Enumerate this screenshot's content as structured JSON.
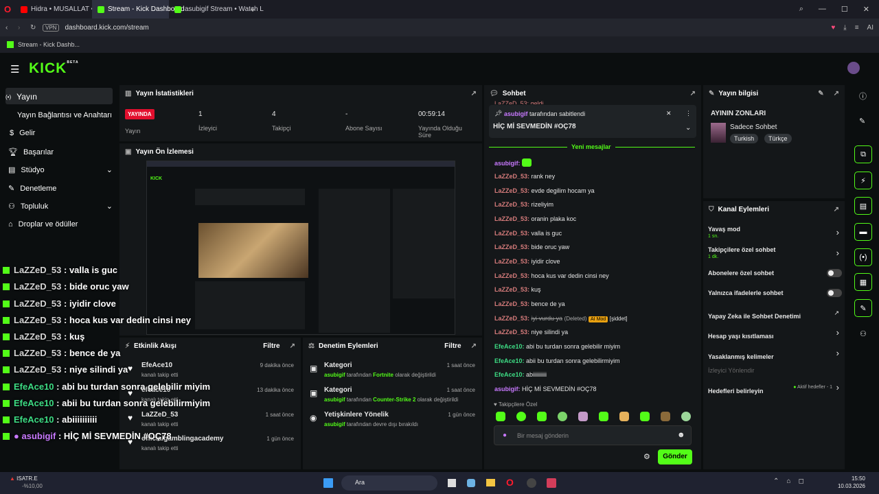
{
  "browser": {
    "tabs": [
      "Hidra • MUSALLAT • YouT",
      "Stream - Kick Dashboard",
      "asubigif Stream • Watch L"
    ],
    "url": "dashboard.kick.com/stream",
    "vpn": "VPN",
    "bookmark": "Stream - Kick Dashb...",
    "ai_label": "AI"
  },
  "header": {
    "logo": "KICK",
    "beta": "BETA"
  },
  "sidebar": {
    "items": [
      "Yayın",
      "Yayın Bağlantısı ve Anahtarı",
      "Gelir",
      "Başarılar",
      "Stüdyo",
      "Denetleme",
      "Topluluk",
      "Droplar ve ödüller"
    ]
  },
  "stats": {
    "title": "Yayın İstatistikleri",
    "live": "YAYINDA",
    "live_label": "Yayın",
    "viewers": "1",
    "viewers_label": "İzleyici",
    "followers": "4",
    "followers_label": "Takipçi",
    "subs": "-",
    "subs_label": "Abone Sayısı",
    "uptime": "00:59:14",
    "uptime_label": "Yayında Olduğu Süre"
  },
  "preview": {
    "title": "Yayın Ön İzlemesi"
  },
  "activity": {
    "title": "Etkinlik Akışı",
    "filter": "Filtre",
    "items": [
      {
        "user": "EfeAce10",
        "text": "kanalı takip etti",
        "time": "9 dakika önce"
      },
      {
        "user": "efeace10",
        "text": "kanalı takip etti",
        "time": "13 dakika önce"
      },
      {
        "user": "LaZZeD_53",
        "text": "kanalı takip etti",
        "time": "1 saat önce"
      },
      {
        "user": "officialgamblingacademy",
        "text": "kanalı takip etti",
        "time": "1 gün önce"
      }
    ]
  },
  "moderation": {
    "title": "Denetim Eylemleri",
    "filter": "Filtre",
    "items": [
      {
        "title": "Kategori",
        "user": "asubigif",
        "pre": "tarafından",
        "target": "Fortnite",
        "post": "olarak değiştirildi",
        "time": "1 saat önce"
      },
      {
        "title": "Kategori",
        "user": "asubigif",
        "pre": "tarafından",
        "target": "Counter-Strike 2",
        "post": "olarak değiştirildi",
        "time": "1 saat önce"
      },
      {
        "title": "Yetişkinlere Yönelik",
        "user": "asubigif",
        "pre": "tarafından devre dışı bırakıldı",
        "target": "",
        "post": "",
        "time": "1 gün önce"
      }
    ]
  },
  "chat": {
    "title": "Sohbet",
    "top_cut": "LaZZeD_53: geldi",
    "pinned_user": "asubigif",
    "pinned_by": "tarafından sabitlendi",
    "pinned_msg": "HİÇ Mİ SEVMEDİN #OÇ78",
    "new_messages": "Yeni mesajlar",
    "messages": [
      {
        "u": "asubigif",
        "m": "",
        "c": "u3"
      },
      {
        "u": "LaZZeD_53",
        "m": "rank ney",
        "c": "u"
      },
      {
        "u": "LaZZeD_53",
        "m": "evde degilim hocam ya",
        "c": "u"
      },
      {
        "u": "LaZZeD_53",
        "m": "rizeliyim",
        "c": "u"
      },
      {
        "u": "LaZZeD_53",
        "m": "oranin plaka koc",
        "c": "u"
      },
      {
        "u": "LaZZeD_53",
        "m": "valla is guc",
        "c": "u"
      },
      {
        "u": "LaZZeD_53",
        "m": "bide oruc yaw",
        "c": "u"
      },
      {
        "u": "LaZZeD_53",
        "m": "iyidir clove",
        "c": "u"
      },
      {
        "u": "LaZZeD_53",
        "m": "hoca kus var dedin cinsi ney",
        "c": "u"
      },
      {
        "u": "LaZZeD_53",
        "m": "kuş",
        "c": "u"
      },
      {
        "u": "LaZZeD_53",
        "m": "bence de ya",
        "c": "u"
      },
      {
        "u": "LaZZeD_53",
        "m": "iyi vurdu ya",
        "c": "u"
      },
      {
        "u": "LaZZeD_53",
        "m": "niye silindi ya",
        "c": "u"
      },
      {
        "u": "EfeAce10",
        "m": "abi bu turdan sonra gelebilir miyim",
        "c": "u2"
      },
      {
        "u": "EfeAce10",
        "m": "abii bu turdan sonra gelebilirmiyim",
        "c": "u2"
      },
      {
        "u": "EfeAce10",
        "m": "abiiiiiiiiii",
        "c": "u2"
      },
      {
        "u": "asubigif",
        "m": "HİÇ Mİ SEVMEDİN #OÇ78",
        "c": "u3"
      }
    ],
    "deleted": "(Deleted)",
    "ai_mod": "AI Mod",
    "violence": "[şiddet]",
    "follower_only": "Takipçilere Özel",
    "placeholder": "Bir mesaj gönderin",
    "send": "Gönder"
  },
  "info": {
    "title": "Yayın bilgisi",
    "stream_title": "AYININ ZONLARI",
    "category": "Sadece Sohbet",
    "tags": [
      "Turkish",
      "Türkçe"
    ]
  },
  "actions": {
    "title": "Kanal Eylemleri",
    "slow": "Yavaş mod",
    "slow_val": "1 sn.",
    "followers": "Takipçilere özel sohbet",
    "followers_val": "1 dk.",
    "subs": "Abonelere özel sohbet",
    "emotes": "Yalnızca ifadelerle sohbet",
    "ai": "Yapay Zeka ile Sohbet Denetimi",
    "age": "Hesap yaşı kısıtlaması",
    "banned": "Yasaklanmış kelimeler",
    "redirect": "İzleyici Yönlendir",
    "goals": "Hedefleri belirleyin",
    "goals_val": "Aktif hedefler - 1"
  },
  "overlay": [
    {
      "u": "LaZZeD_53",
      "m": "valla is guc",
      "c": "n"
    },
    {
      "u": "LaZZeD_53",
      "m": "bide oruc yaw",
      "c": "n"
    },
    {
      "u": "LaZZeD_53",
      "m": "iyidir clove",
      "c": "n"
    },
    {
      "u": "LaZZeD_53",
      "m": "hoca kus var dedin cinsi ney",
      "c": "n"
    },
    {
      "u": "LaZZeD_53",
      "m": "kuş",
      "c": "n"
    },
    {
      "u": "LaZZeD_53",
      "m": "bence de ya",
      "c": "n"
    },
    {
      "u": "LaZZeD_53",
      "m": "niye silindi ya",
      "c": "n"
    },
    {
      "u": "EfeAce10",
      "m": "abi bu turdan sonra gelebilir miyim",
      "c": "n2"
    },
    {
      "u": "EfeAce10",
      "m": "abii bu turdan sonra gelebilirmiyim",
      "c": "n2"
    },
    {
      "u": "EfeAce10",
      "m": "abiiiiiiiiii",
      "c": "n2"
    },
    {
      "u": "asubigif",
      "m": "HİÇ Mİ SEVMEDİN #OÇ78",
      "c": "n3"
    }
  ],
  "taskbar": {
    "ticker": "ISATR.E",
    "change": "-%10,00",
    "search": "Ara",
    "time": "15:50",
    "date": "10.03.2026"
  }
}
